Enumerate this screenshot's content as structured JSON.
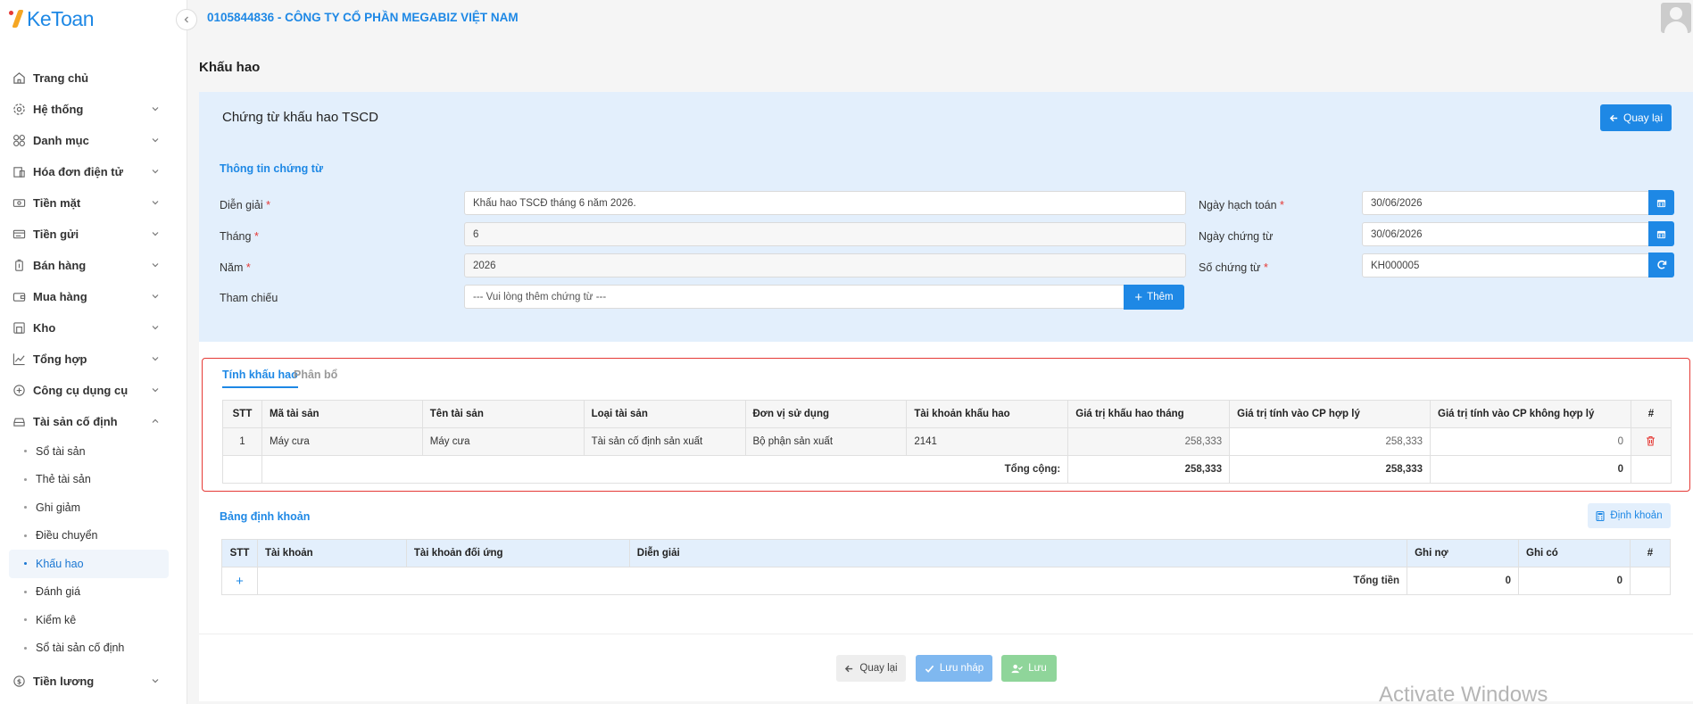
{
  "app": {
    "logo_text": "KeToan"
  },
  "header": {
    "company": "0105844836 - CÔNG TY CỔ PHẦN MEGABIZ VIỆT NAM"
  },
  "sidebar": {
    "items": [
      {
        "label": "Trang chủ",
        "icon": "home-icon"
      },
      {
        "label": "Hệ thống",
        "icon": "gear-icon"
      },
      {
        "label": "Danh mục",
        "icon": "grid-icon"
      },
      {
        "label": "Hóa đơn điện tử",
        "icon": "invoice-icon"
      },
      {
        "label": "Tiền mặt",
        "icon": "cash-icon"
      },
      {
        "label": "Tiền gửi",
        "icon": "bank-card-icon"
      },
      {
        "label": "Bán hàng",
        "icon": "sales-icon"
      },
      {
        "label": "Mua hàng",
        "icon": "wallet-icon"
      },
      {
        "label": "Kho",
        "icon": "warehouse-icon"
      },
      {
        "label": "Tổng hợp",
        "icon": "chart-icon"
      },
      {
        "label": "Công cụ dụng cụ",
        "icon": "tools-icon"
      },
      {
        "label": "Tài sản cố định",
        "icon": "car-icon"
      }
    ],
    "sub_items": [
      {
        "label": "Sổ tài sản"
      },
      {
        "label": "Thẻ tài sản"
      },
      {
        "label": "Ghi giảm"
      },
      {
        "label": "Điều chuyển"
      },
      {
        "label": "Khấu hao"
      },
      {
        "label": "Đánh giá"
      },
      {
        "label": "Kiểm kê"
      },
      {
        "label": "Sổ tài sản cố định"
      }
    ],
    "after": [
      {
        "label": "Tiền lương",
        "icon": "salary-icon"
      }
    ]
  },
  "page": {
    "title": "Khấu hao"
  },
  "voucher": {
    "title": "Chứng từ khấu hao TSCD",
    "back_label": "Quay lại",
    "section": "Thông tin chứng từ",
    "dien_giai_label": "Diễn giải",
    "dien_giai_value": "Khấu hao TSCĐ tháng 6 năm 2026.",
    "thang_label": "Tháng",
    "thang_value": "6",
    "nam_label": "Năm",
    "nam_value": "2026",
    "tham_chieu_label": "Tham chiếu",
    "tham_chieu_placeholder": "--- Vui lòng thêm chứng từ ---",
    "add_label": "Thêm",
    "ngay_hach_toan_label": "Ngày hạch toán",
    "ngay_hach_toan_value": "30/06/2026",
    "ngay_chung_tu_label": "Ngày chứng từ",
    "ngay_chung_tu_value": "30/06/2026",
    "so_chung_tu_label": "Số chứng từ",
    "so_chung_tu_value": "KH000005",
    "required_mark": "*"
  },
  "tabs": [
    {
      "label": "Tính khấu hao"
    },
    {
      "label": "Phân bổ"
    }
  ],
  "dep_table": {
    "headers": [
      "STT",
      "Mã tài sản",
      "Tên tài sản",
      "Loại tài sản",
      "Đơn vị sử dụng",
      "Tài khoản khấu hao",
      "Giá trị khấu hao tháng",
      "Giá trị tính vào CP hợp lý",
      "Giá trị tính vào CP không hợp lý",
      "#"
    ],
    "rows": [
      [
        "1",
        "Máy cưa",
        "Máy cưa",
        "Tài sản cố định sản xuất",
        "Bộ phận sản xuất",
        "2141",
        "258,333",
        "258,333",
        "0"
      ]
    ],
    "total_label": "Tổng cộng:",
    "totals": [
      "258,333",
      "258,333",
      "0"
    ]
  },
  "acct": {
    "title": "Bảng định khoản",
    "button_label": "Định khoản",
    "headers": [
      "STT",
      "Tài khoản",
      "Tài khoản đối ứng",
      "Diễn giải",
      "Ghi nợ",
      "Ghi có",
      "#"
    ],
    "add_symbol": "+",
    "total_label": "Tổng tiền",
    "totals": [
      "0",
      "0"
    ]
  },
  "footer": {
    "back_label": "Quay lại",
    "draft_label": "Lưu nháp",
    "save_label": "Lưu"
  },
  "watermark": "Activate Windows"
}
